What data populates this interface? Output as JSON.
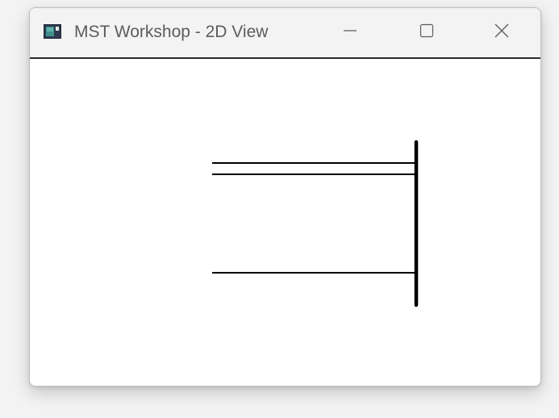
{
  "window": {
    "title": "MST Workshop - 2D View"
  },
  "titlebar": {
    "app_icon": "application-window-icon",
    "minimize_icon": "minimize-icon",
    "maximize_icon": "maximize-icon",
    "close_icon": "close-icon"
  },
  "colors": {
    "titlebar_bg": "#f3f3f3",
    "title_text": "#5c5c5c",
    "canvas_bg": "#ffffff",
    "line": "#000000"
  }
}
